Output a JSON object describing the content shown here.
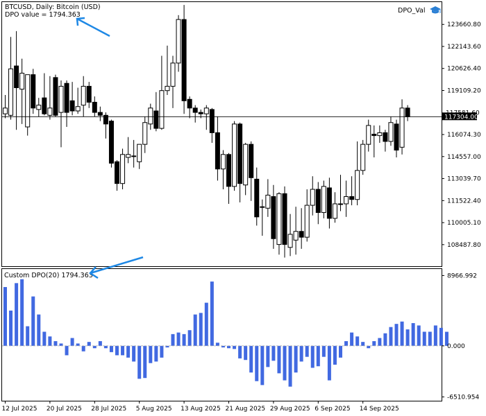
{
  "main_chart": {
    "symbol_line": "BTCUSD, Daily:  Bitcoin (USD)",
    "indicator_line": "DPO value = 1794.363",
    "ea_label": "DPO_Val",
    "ea_icon": "graduation-cap-icon",
    "current_price_label": "117304.00",
    "hidden_label": "117581.60"
  },
  "sub_window": {
    "title": "Custom DPO(20) 1794.363"
  },
  "colors": {
    "bull_candle": "#ffffff",
    "bear_candle": "#000000",
    "dpo_bar": "#4169e1",
    "arrow": "#1e88e5",
    "zero_line": "#b0b0b0"
  },
  "chart_data": [
    {
      "type": "candlestick",
      "title": "BTCUSD, Daily:  Bitcoin (USD)",
      "y_ticks": [
        123660.8,
        122143.6,
        120626.4,
        119109.2,
        117591.6,
        116074.3,
        114557.0,
        113039.7,
        111522.4,
        110005.1,
        108487.8
      ],
      "ylim": [
        107000,
        125200
      ],
      "x_tick_labels": [
        "12 Jul 2025",
        "20 Jul 2025",
        "28 Jul 2025",
        "5 Aug 2025",
        "13 Aug 2025",
        "21 Aug 2025",
        "29 Aug 2025",
        "6 Sep 2025",
        "14 Sep 2025"
      ],
      "x_tick_index": [
        0,
        8,
        16,
        24,
        32,
        40,
        48,
        56,
        64
      ],
      "current_price": 117304.0,
      "candles": [
        {
          "o": 117500,
          "h": 118800,
          "l": 117200,
          "c": 117900
        },
        {
          "o": 117400,
          "h": 122800,
          "l": 117100,
          "c": 120600
        },
        {
          "o": 120800,
          "h": 123200,
          "l": 116400,
          "c": 119300
        },
        {
          "o": 119200,
          "h": 121300,
          "l": 116800,
          "c": 120300
        },
        {
          "o": 116600,
          "h": 120100,
          "l": 116000,
          "c": 120200
        },
        {
          "o": 120200,
          "h": 120600,
          "l": 117500,
          "c": 117900
        },
        {
          "o": 117800,
          "h": 118600,
          "l": 117300,
          "c": 118100
        },
        {
          "o": 118600,
          "h": 120300,
          "l": 117400,
          "c": 117500
        },
        {
          "o": 117400,
          "h": 120100,
          "l": 117100,
          "c": 117900
        },
        {
          "o": 120000,
          "h": 120200,
          "l": 117300,
          "c": 117400
        },
        {
          "o": 117600,
          "h": 119800,
          "l": 115200,
          "c": 119400
        },
        {
          "o": 119600,
          "h": 119800,
          "l": 116600,
          "c": 117600
        },
        {
          "o": 118400,
          "h": 119700,
          "l": 117400,
          "c": 117700
        },
        {
          "o": 117700,
          "h": 119300,
          "l": 117500,
          "c": 118000
        },
        {
          "o": 118100,
          "h": 120100,
          "l": 117300,
          "c": 119400
        },
        {
          "o": 119400,
          "h": 119700,
          "l": 117900,
          "c": 118300
        },
        {
          "o": 118300,
          "h": 118700,
          "l": 117300,
          "c": 117600
        },
        {
          "o": 117600,
          "h": 118000,
          "l": 117000,
          "c": 117400
        },
        {
          "o": 117400,
          "h": 117600,
          "l": 115800,
          "c": 116800
        },
        {
          "o": 117000,
          "h": 117100,
          "l": 113800,
          "c": 114100
        },
        {
          "o": 114200,
          "h": 114300,
          "l": 112200,
          "c": 112700
        },
        {
          "o": 112700,
          "h": 115100,
          "l": 112300,
          "c": 114700
        },
        {
          "o": 114500,
          "h": 115900,
          "l": 114100,
          "c": 114700
        },
        {
          "o": 114600,
          "h": 115700,
          "l": 113800,
          "c": 114600
        },
        {
          "o": 114200,
          "h": 115400,
          "l": 113700,
          "c": 115400
        },
        {
          "o": 115400,
          "h": 117300,
          "l": 114800,
          "c": 116900
        },
        {
          "o": 116800,
          "h": 118200,
          "l": 116400,
          "c": 117900
        },
        {
          "o": 117700,
          "h": 119000,
          "l": 116300,
          "c": 116500
        },
        {
          "o": 116500,
          "h": 121500,
          "l": 116400,
          "c": 119100
        },
        {
          "o": 119100,
          "h": 122200,
          "l": 118800,
          "c": 119400
        },
        {
          "o": 119400,
          "h": 121500,
          "l": 117900,
          "c": 121000
        },
        {
          "o": 121000,
          "h": 124300,
          "l": 120400,
          "c": 124000
        },
        {
          "o": 124000,
          "h": 125000,
          "l": 117500,
          "c": 118400
        },
        {
          "o": 118500,
          "h": 118700,
          "l": 117200,
          "c": 117900
        },
        {
          "o": 117900,
          "h": 118100,
          "l": 116900,
          "c": 117600
        },
        {
          "o": 117600,
          "h": 117800,
          "l": 117200,
          "c": 117500
        },
        {
          "o": 117500,
          "h": 118100,
          "l": 116400,
          "c": 117900
        },
        {
          "o": 117800,
          "h": 117900,
          "l": 115500,
          "c": 116200
        },
        {
          "o": 116200,
          "h": 117300,
          "l": 112900,
          "c": 113700
        },
        {
          "o": 113700,
          "h": 115000,
          "l": 112300,
          "c": 114700
        },
        {
          "o": 114700,
          "h": 114800,
          "l": 111300,
          "c": 112500
        },
        {
          "o": 112500,
          "h": 117000,
          "l": 112200,
          "c": 116800
        },
        {
          "o": 116800,
          "h": 116900,
          "l": 111400,
          "c": 112700
        },
        {
          "o": 112600,
          "h": 115500,
          "l": 111900,
          "c": 115400
        },
        {
          "o": 115400,
          "h": 115600,
          "l": 111500,
          "c": 113100
        },
        {
          "o": 113000,
          "h": 113800,
          "l": 109800,
          "c": 110400
        },
        {
          "o": 111100,
          "h": 111600,
          "l": 109100,
          "c": 111100
        },
        {
          "o": 111000,
          "h": 113000,
          "l": 110400,
          "c": 111900
        },
        {
          "o": 111800,
          "h": 112600,
          "l": 108200,
          "c": 108900
        },
        {
          "o": 108500,
          "h": 112100,
          "l": 107800,
          "c": 112000
        },
        {
          "o": 112000,
          "h": 112500,
          "l": 107600,
          "c": 108500
        },
        {
          "o": 108300,
          "h": 110600,
          "l": 107700,
          "c": 109200
        },
        {
          "o": 108800,
          "h": 111100,
          "l": 107800,
          "c": 109400
        },
        {
          "o": 109400,
          "h": 111000,
          "l": 108200,
          "c": 109000
        },
        {
          "o": 109000,
          "h": 112300,
          "l": 108700,
          "c": 111200
        },
        {
          "o": 111200,
          "h": 113200,
          "l": 110500,
          "c": 112300
        },
        {
          "o": 112300,
          "h": 112800,
          "l": 109900,
          "c": 110700
        },
        {
          "o": 110700,
          "h": 112900,
          "l": 110300,
          "c": 112500
        },
        {
          "o": 112400,
          "h": 113100,
          "l": 109600,
          "c": 110300
        },
        {
          "o": 110300,
          "h": 112100,
          "l": 110000,
          "c": 111300
        },
        {
          "o": 111300,
          "h": 113300,
          "l": 110800,
          "c": 111300
        },
        {
          "o": 111300,
          "h": 112900,
          "l": 110400,
          "c": 111800
        },
        {
          "o": 111800,
          "h": 113200,
          "l": 111200,
          "c": 111600
        },
        {
          "o": 111600,
          "h": 115600,
          "l": 111200,
          "c": 113600
        },
        {
          "o": 113600,
          "h": 115700,
          "l": 113300,
          "c": 115400
        },
        {
          "o": 115400,
          "h": 117100,
          "l": 114900,
          "c": 116700
        },
        {
          "o": 116100,
          "h": 116700,
          "l": 114500,
          "c": 116000
        },
        {
          "o": 116000,
          "h": 116700,
          "l": 115500,
          "c": 116200
        },
        {
          "o": 116200,
          "h": 116400,
          "l": 114900,
          "c": 115600
        },
        {
          "o": 115600,
          "h": 117300,
          "l": 115300,
          "c": 116900
        },
        {
          "o": 116800,
          "h": 117100,
          "l": 114500,
          "c": 115000
        },
        {
          "o": 115200,
          "h": 118500,
          "l": 114700,
          "c": 117900
        },
        {
          "o": 117900,
          "h": 118100,
          "l": 117000,
          "c": 117300
        }
      ]
    },
    {
      "type": "bar",
      "title": "Custom DPO(20) 1794.363",
      "y_ticks": [
        8966.992,
        0.0,
        -6510.954
      ],
      "ylim": [
        -7000,
        9800
      ],
      "value_label": "1794.363",
      "values": [
        7500,
        4500,
        8000,
        8500,
        2500,
        6300,
        4000,
        1800,
        1200,
        600,
        300,
        -1200,
        1000,
        300,
        -700,
        500,
        -300,
        600,
        -300,
        -800,
        -1200,
        -1200,
        -1500,
        -2000,
        -4200,
        -4100,
        -2200,
        -2000,
        -1500,
        -200,
        1500,
        1700,
        1500,
        2000,
        4000,
        4200,
        5500,
        8200,
        400,
        -200,
        -300,
        -400,
        -1600,
        -1800,
        -3400,
        -4500,
        -5000,
        -2700,
        -1900,
        -3500,
        -4400,
        -5200,
        -3400,
        -2000,
        -1400,
        -2800,
        -2600,
        -1400,
        -4400,
        -2400,
        -1500,
        600,
        1700,
        1200,
        500,
        -300,
        600,
        1000,
        1600,
        2400,
        2800,
        3100,
        2100,
        2900,
        2600,
        1800,
        1800,
        2600,
        2300,
        1794
      ]
    }
  ]
}
